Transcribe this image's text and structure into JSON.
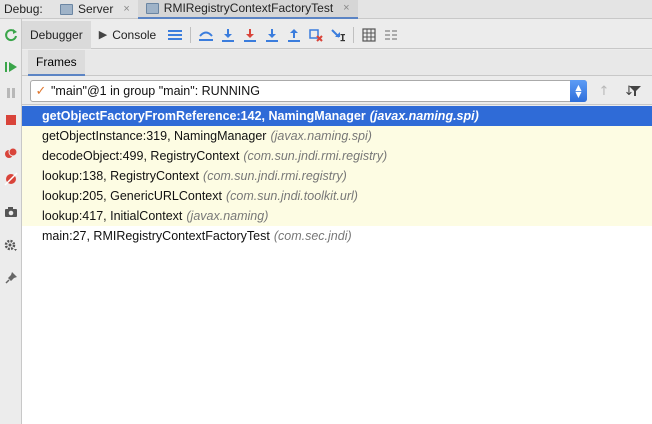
{
  "topbar": {
    "label": "Debug:",
    "tabs": [
      {
        "label": "Server",
        "close": "×",
        "active": false
      },
      {
        "label": "RMIRegistryContextFactoryTest",
        "close": "×",
        "active": true
      }
    ]
  },
  "toolbar": {
    "debugger_tab": "Debugger",
    "console_tab": "Console"
  },
  "frames_tab": "Frames",
  "thread_selector": {
    "value": "\"main\"@1 in group \"main\": RUNNING"
  },
  "frames": [
    {
      "method": "getObjectFactoryFromReference:142, NamingManager",
      "package": "(javax.naming.spi)",
      "selected": true,
      "library": false
    },
    {
      "method": "getObjectInstance:319, NamingManager",
      "package": "(javax.naming.spi)",
      "selected": false,
      "library": true
    },
    {
      "method": "decodeObject:499, RegistryContext",
      "package": "(com.sun.jndi.rmi.registry)",
      "selected": false,
      "library": true
    },
    {
      "method": "lookup:138, RegistryContext",
      "package": "(com.sun.jndi.rmi.registry)",
      "selected": false,
      "library": true
    },
    {
      "method": "lookup:205, GenericURLContext",
      "package": "(com.sun.jndi.toolkit.url)",
      "selected": false,
      "library": true
    },
    {
      "method": "lookup:417, InitialContext",
      "package": "(javax.naming)",
      "selected": false,
      "library": true
    },
    {
      "method": "main:27, RMIRegistryContextFactoryTest",
      "package": "(com.sec.jndi)",
      "selected": false,
      "library": false
    }
  ],
  "colors": {
    "selection": "#2f6bd7",
    "library_frame_bg": "#fdfce3",
    "accent_blue": "#3b7ddd",
    "stop_red": "#d9443a",
    "resume_green": "#3aa54a"
  }
}
